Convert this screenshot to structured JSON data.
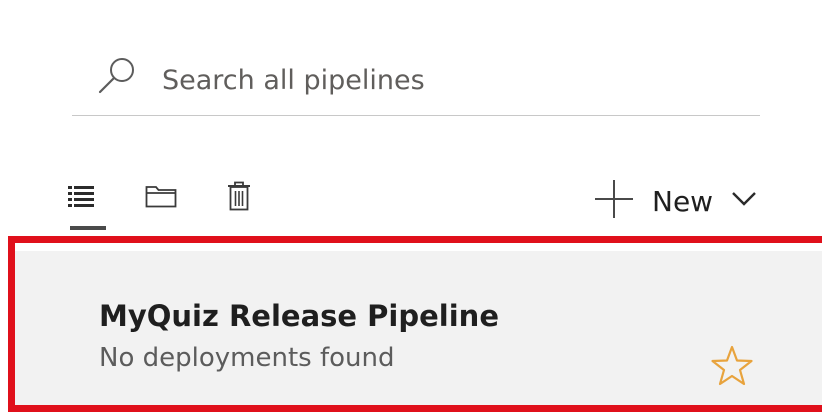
{
  "search": {
    "placeholder": "Search all pipelines"
  },
  "toolbar": {
    "views": [
      {
        "name": "list-view",
        "icon": "list-icon",
        "active": true
      },
      {
        "name": "folder-view",
        "icon": "folder-icon",
        "active": false
      },
      {
        "name": "deleted-view",
        "icon": "trash-icon",
        "active": false
      }
    ],
    "new_button": {
      "label": "New",
      "icon": "plus-icon",
      "dropdown_icon": "chevron-down-icon"
    }
  },
  "pipelines": [
    {
      "name": "MyQuiz Release Pipeline",
      "status": "No deployments found",
      "favorite_icon": "star-icon"
    }
  ],
  "colors": {
    "highlight_border": "#e0101b",
    "row_background": "#f2f2f2",
    "star": "#e8a33d",
    "active_underline": "#4a4a4a"
  }
}
